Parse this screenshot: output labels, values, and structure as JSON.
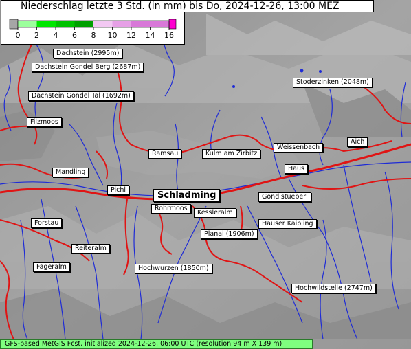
{
  "title": "Niederschlag letzte 3 Std. (in mm) bis Do, 2024-12-26, 13:00 MEZ",
  "legend": {
    "ticks": [
      "0",
      "2",
      "4",
      "6",
      "8",
      "10",
      "12",
      "14",
      "16"
    ],
    "colors": [
      "#a6a6a6",
      "#9cff9c",
      "#00e600",
      "#00c200",
      "#00a000",
      "#f2c8f2",
      "#e6a0e6",
      "#d878d8",
      "#ff00d0"
    ]
  },
  "places": [
    {
      "name": "Dachstein (2995m)"
    },
    {
      "name": "Dachstein Gondel Berg (2687m)"
    },
    {
      "name": "Dachstein Gondel Tal (1692m)"
    },
    {
      "name": "Stoderzinken (2048m)"
    },
    {
      "name": "Filzmoos"
    },
    {
      "name": "Weissenbach"
    },
    {
      "name": "Aich"
    },
    {
      "name": "Ramsau"
    },
    {
      "name": "Kulm am Zirbitz"
    },
    {
      "name": "Mandling"
    },
    {
      "name": "Haus"
    },
    {
      "name": "Pichl"
    },
    {
      "name": "Schladming"
    },
    {
      "name": "Gondlstueberl"
    },
    {
      "name": "Rohrmoos"
    },
    {
      "name": "Kessleralm"
    },
    {
      "name": "Forstau"
    },
    {
      "name": "Hauser Kaibling"
    },
    {
      "name": "Planai (1906m)"
    },
    {
      "name": "Reiteralm"
    },
    {
      "name": "Fageralm"
    },
    {
      "name": "Hochwurzen (1850m)"
    },
    {
      "name": "Hochwildstelle (2747m)"
    }
  ],
  "footer": "GFS-based MetGIS Fcst, initialized 2024-12-26, 06:00 UTC  (resolution 94 m X 139 m)"
}
